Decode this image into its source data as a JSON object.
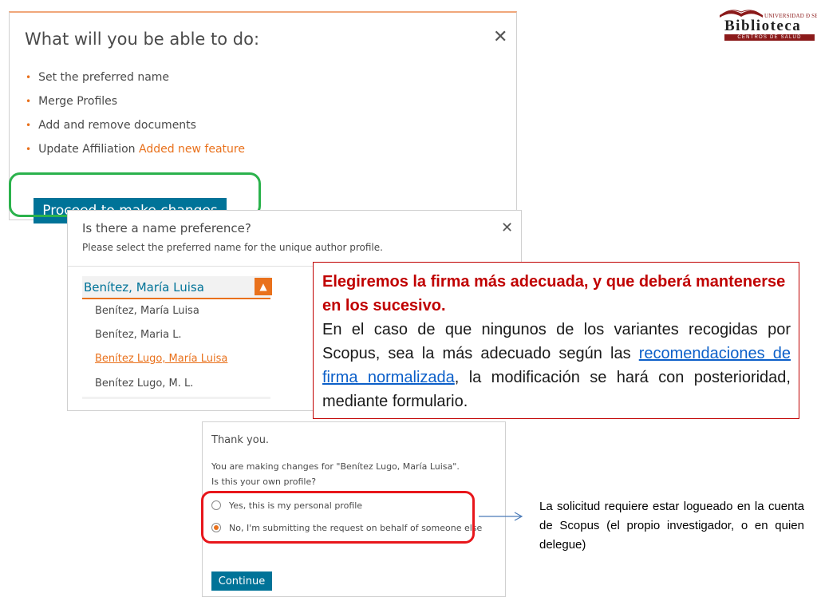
{
  "dialog1": {
    "title": "What will you be able to do:",
    "close_glyph": "✕",
    "items": [
      {
        "text": "Set the preferred name",
        "tag": ""
      },
      {
        "text": "Merge Profiles",
        "tag": ""
      },
      {
        "text": "Add and remove documents",
        "tag": ""
      },
      {
        "text": "Update Affiliation",
        "tag": "Added new feature"
      }
    ],
    "proceed_label": "Proceed to make changes"
  },
  "dialog2": {
    "question": "Is there a name preference?",
    "subtitle": "Please select the preferred name for the unique author profile.",
    "close_glyph": "✕",
    "selected_value": "Benítez, María Luisa",
    "toggle_glyph": "▲",
    "options": [
      "Benítez, María Luisa",
      "Benítez, Maria L.",
      "Benítez Lugo, María Luisa",
      "Benítez Lugo, M. L."
    ],
    "highlighted_option_index": 2
  },
  "note1": {
    "heading": "Elegiremos la firma más adecuada, y que deberá mantenerse en los sucesivo.",
    "body_before": "En el caso de que ningunos de los variantes recogidas por Scopus, sea la más adecuado según las ",
    "link_text": "recomendaciones de firma normalizada",
    "body_after": ", la modificación se hará con posterioridad, mediante formulario."
  },
  "dialog3": {
    "thanks": "Thank you.",
    "making_changes": "You are making changes for \"Benítez Lugo, María Luisa\".",
    "own_profile": "Is this your own profile?",
    "option_yes": "Yes, this is my personal profile",
    "option_no": "No, I'm submitting the request on behalf of someone else",
    "selected": "option_no",
    "continue_label": "Continue"
  },
  "note2": {
    "text": "La solicitud requiere estar logueado en la cuenta de Scopus (el propio investigador, o en quien delegue)"
  },
  "logo": {
    "line1": "UNIVERSIDAD Ð SEVILLA",
    "line2": "Biblioteca",
    "line3": "CENTROS DE SALUD"
  },
  "colors": {
    "accent_orange": "#e9711c",
    "primary_teal": "#007398",
    "highlight_green": "#2bb24c",
    "highlight_red": "#e8161b",
    "note_red": "#c00000"
  }
}
